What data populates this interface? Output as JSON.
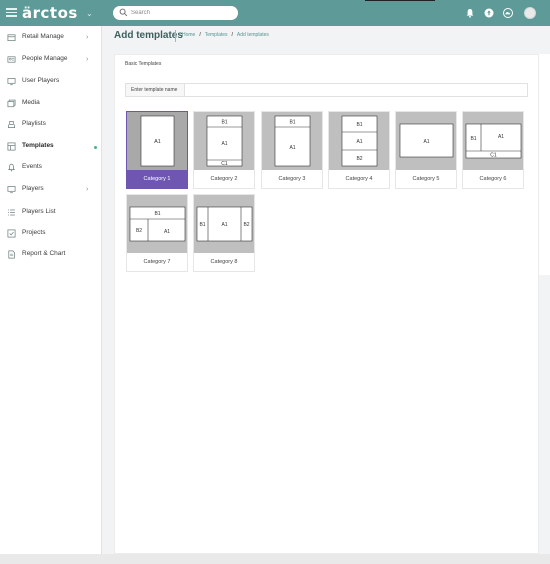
{
  "brand": {
    "logo_text": "ärctos"
  },
  "search": {
    "placeholder": "Search"
  },
  "sidebar": {
    "items": [
      {
        "label": "Retail Manage",
        "icon": "retail-icon",
        "has_chevron": true
      },
      {
        "label": "People Manage",
        "icon": "people-icon",
        "has_chevron": true
      },
      {
        "label": "User Players",
        "icon": "monitor-icon",
        "has_chevron": false
      },
      {
        "label": "Media",
        "icon": "media-icon",
        "has_chevron": false
      },
      {
        "label": "Playlists",
        "icon": "playlist-icon",
        "has_chevron": false
      },
      {
        "label": "Templates",
        "icon": "template-icon",
        "has_chevron": false,
        "active": true
      },
      {
        "label": "Events",
        "icon": "bell-icon",
        "has_chevron": false
      },
      {
        "label": "Players",
        "icon": "monitor-icon",
        "has_chevron": true
      },
      {
        "label": "Players List",
        "icon": "list-icon",
        "has_chevron": false
      },
      {
        "label": "Projects",
        "icon": "projects-icon",
        "has_chevron": false
      },
      {
        "label": "Report & Chart",
        "icon": "report-icon",
        "has_chevron": false
      }
    ]
  },
  "header": {
    "title": "Add templates",
    "breadcrumb": [
      "Home",
      "Templates",
      "Add templates"
    ]
  },
  "main": {
    "section_label": "Basic Templates",
    "name_field_label": "Enter template name",
    "name_field_value": ""
  },
  "templates": [
    {
      "label": "Category 1",
      "selected": true,
      "regions": [
        "A1"
      ]
    },
    {
      "label": "Category 2",
      "selected": false,
      "regions": [
        "B1",
        "A1",
        "C1"
      ]
    },
    {
      "label": "Category 3",
      "selected": false,
      "regions": [
        "B1",
        "A1"
      ]
    },
    {
      "label": "Category 4",
      "selected": false,
      "regions": [
        "B1",
        "A1",
        "B2"
      ]
    },
    {
      "label": "Category 5",
      "selected": false,
      "regions": [
        "A1"
      ]
    },
    {
      "label": "Category 6",
      "selected": false,
      "regions": [
        "B1",
        "A1",
        "C1"
      ]
    },
    {
      "label": "Category 7",
      "selected": false,
      "regions": [
        "B1",
        "B2",
        "A1"
      ]
    },
    {
      "label": "Category 8",
      "selected": false,
      "regions": [
        "B1",
        "A1",
        "B2"
      ]
    }
  ],
  "colors": {
    "topbar": "#5e9a98",
    "accent": "#6f57b1",
    "active_dot": "#4caf8f"
  },
  "icons": {
    "top": [
      "bell-icon",
      "upload-icon",
      "cloud-icon",
      "user-avatar-icon"
    ]
  }
}
